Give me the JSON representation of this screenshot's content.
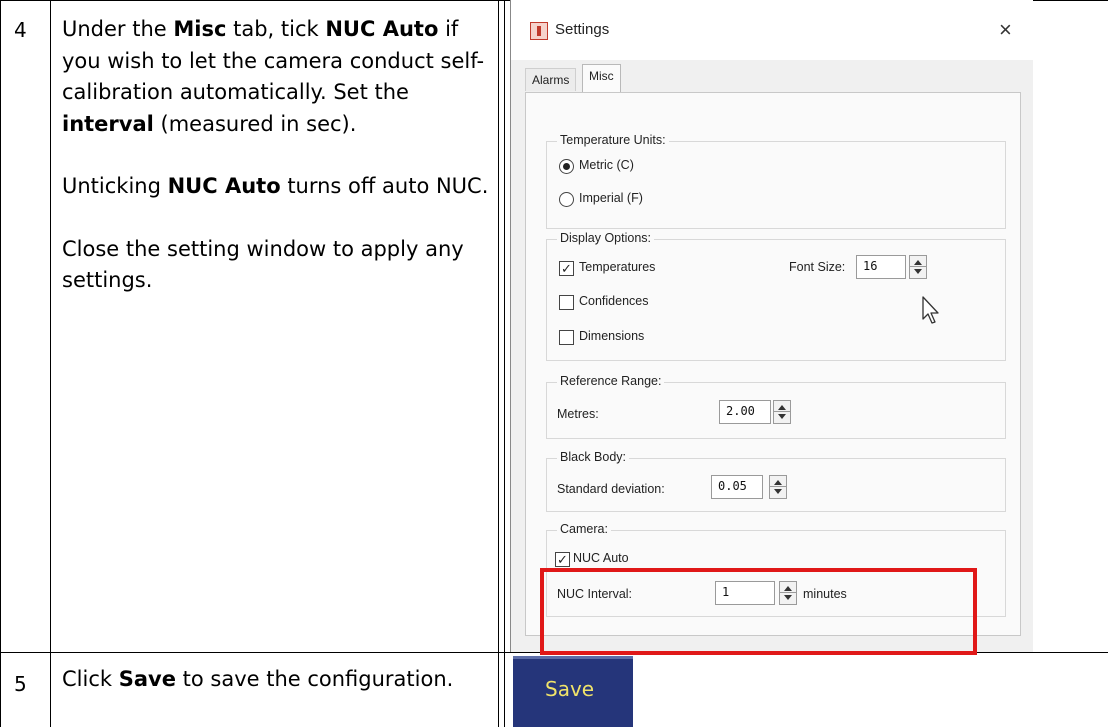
{
  "rows": [
    {
      "number": "4",
      "p1": [
        "Under the ",
        "Misc",
        " tab, tick ",
        "NUC Auto",
        " if you wish to let the camera conduct self-calibration automatically. Set the ",
        "interval",
        " (measured in sec)."
      ],
      "p2": [
        "Unticking ",
        "NUC Auto",
        " turns off auto NUC."
      ],
      "p3": "Close the setting window to apply any settings."
    },
    {
      "number": "5",
      "p1": [
        "Click ",
        "Save",
        " to save the configuration."
      ]
    }
  ],
  "settings_window": {
    "title": "Settings",
    "close_glyph": "×",
    "tabs": [
      "Alarms",
      "Misc"
    ],
    "active_tab": "Misc",
    "temperature_units": {
      "label": "Temperature Units:",
      "options": [
        "Metric (C)",
        "Imperial (F)"
      ],
      "selected": "Metric (C)"
    },
    "display_options": {
      "label": "Display Options:",
      "temperatures": {
        "label": "Temperatures",
        "checked": true
      },
      "confidences": {
        "label": "Confidences",
        "checked": false
      },
      "dimensions": {
        "label": "Dimensions",
        "checked": false
      },
      "font_size_label": "Font Size:",
      "font_size_value": "16"
    },
    "reference_range": {
      "label": "Reference Range:",
      "metres_label": "Metres:",
      "metres_value": "2.00"
    },
    "black_body": {
      "label": "Black Body:",
      "std_label": "Standard deviation:",
      "std_value": "0.05"
    },
    "camera": {
      "label": "Camera:",
      "nuc_auto": {
        "label": "NUC Auto",
        "checked": true
      },
      "interval_label": "NUC Interval:",
      "interval_value": "1",
      "interval_unit": "minutes"
    }
  },
  "save_button": {
    "label": "Save"
  },
  "colors": {
    "highlight": "#e01818",
    "save_bg": "#25357a",
    "save_text": "#f0e36a"
  },
  "icons": {
    "cursor": "mouse-pointer-icon",
    "app": "thermal-camera-app-icon"
  }
}
